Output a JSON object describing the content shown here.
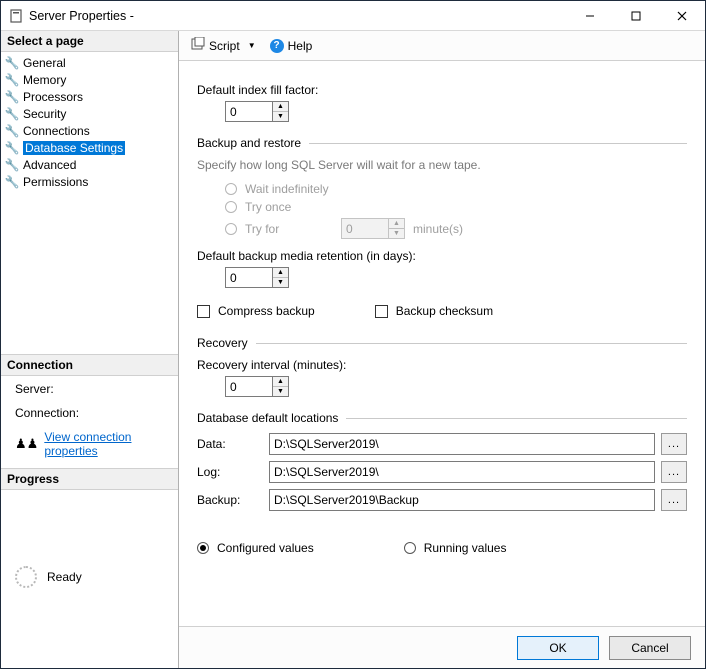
{
  "window": {
    "title": "Server Properties -"
  },
  "sidebar": {
    "select_page": "Select a page",
    "items": [
      {
        "label": "General"
      },
      {
        "label": "Memory"
      },
      {
        "label": "Processors"
      },
      {
        "label": "Security"
      },
      {
        "label": "Connections"
      },
      {
        "label": "Database Settings",
        "selected": true
      },
      {
        "label": "Advanced"
      },
      {
        "label": "Permissions"
      }
    ],
    "connection_head": "Connection",
    "server_label": "Server:",
    "server_value": "",
    "connection_label": "Connection:",
    "connection_value": "",
    "view_props": "View connection properties",
    "progress_head": "Progress",
    "progress_status": "Ready"
  },
  "toolbar": {
    "script": "Script",
    "help": "Help"
  },
  "content": {
    "default_fill_factor_label": "Default index fill factor:",
    "default_fill_factor_value": "0",
    "backup_restore_head": "Backup and restore",
    "backup_hint": "Specify how long SQL Server will wait for a new tape.",
    "wait_indef": "Wait indefinitely",
    "try_once": "Try once",
    "try_for": "Try for",
    "try_for_value": "0",
    "try_for_unit": "minute(s)",
    "retention_label": "Default backup media retention (in days):",
    "retention_value": "0",
    "compress_backup": "Compress backup",
    "backup_checksum": "Backup checksum",
    "recovery_head": "Recovery",
    "recovery_interval_label": "Recovery interval (minutes):",
    "recovery_interval_value": "0",
    "locations_head": "Database default locations",
    "data_label": "Data:",
    "data_value": "D:\\SQLServer2019\\",
    "log_label": "Log:",
    "log_value": "D:\\SQLServer2019\\",
    "backup_label": "Backup:",
    "backup_value": "D:\\SQLServer2019\\Backup",
    "configured": "Configured values",
    "running": "Running values"
  },
  "footer": {
    "ok": "OK",
    "cancel": "Cancel"
  }
}
